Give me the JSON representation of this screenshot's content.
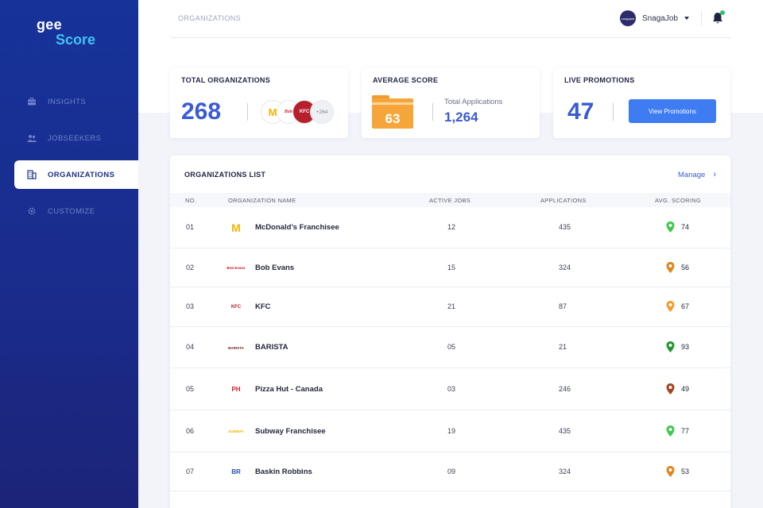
{
  "app": {
    "logo_line1": "gee",
    "logo_line2": "Score"
  },
  "sidebar": {
    "items": [
      {
        "label": "INSIGHTS",
        "icon": "briefcase-icon",
        "active": false
      },
      {
        "label": "JOBSEEKERS",
        "icon": "users-icon",
        "active": false
      },
      {
        "label": "ORGANIZATIONS",
        "icon": "building-icon",
        "active": true
      },
      {
        "label": "CUSTOMIZE",
        "icon": "gear-icon",
        "active": false
      }
    ]
  },
  "header": {
    "breadcrumb": "ORGANIZATIONS",
    "user_name": "SnagaJob",
    "avatar_text": "snagajob"
  },
  "cards": {
    "total_orgs": {
      "title": "TOTAL ORGANIZATIONS",
      "value": "268",
      "more": "+264"
    },
    "avg_score": {
      "title": "AVERAGE SCORE",
      "value": "63",
      "total_apps_label": "Total Applications",
      "total_apps_value": "1,264"
    },
    "promotions": {
      "title": "LIVE  PROMOTIONS",
      "value": "47",
      "button": "View Promotions"
    }
  },
  "list": {
    "title": "ORGANIZATIONS LIST",
    "manage": "Manage",
    "columns": [
      "NO.",
      "ORGANIZATION NAME",
      "ACTIVE JOBS",
      "APPLICATIONS",
      "AVG. SCORING"
    ],
    "rows": [
      {
        "no": "01",
        "name": "McDonald’s Franchisee",
        "jobs": "12",
        "apps": "435",
        "score": "74",
        "pin_color": "#3cc84a",
        "logo_text": "M",
        "logo_color": "#f5b400"
      },
      {
        "no": "02",
        "name": "Bob Evans",
        "jobs": "15",
        "apps": "324",
        "score": "56",
        "pin_color": "#e0861f",
        "logo_text": "Bob Evans",
        "logo_color": "#c8202b"
      },
      {
        "no": "03",
        "name": "KFC",
        "jobs": "21",
        "apps": "87",
        "score": "67",
        "pin_color": "#f29b31",
        "logo_text": "KFC",
        "logo_color": "#b81f2c"
      },
      {
        "no": "04",
        "name": "BARISTA",
        "jobs": "05",
        "apps": "21",
        "score": "93",
        "pin_color": "#21962e",
        "logo_text": "BARISTA",
        "logo_color": "#6a1c1c"
      },
      {
        "no": "05",
        "name": "Pizza Hut - Canada",
        "jobs": "03",
        "apps": "246",
        "score": "49",
        "pin_color": "#a8421a",
        "logo_text": "PH",
        "logo_color": "#d3222a"
      },
      {
        "no": "06",
        "name": "Subway Franchisee",
        "jobs": "19",
        "apps": "435",
        "score": "77",
        "pin_color": "#3cc84a",
        "logo_text": "SUBWAY",
        "logo_color": "#f2b200"
      },
      {
        "no": "07",
        "name": "Baskin Robbins",
        "jobs": "09",
        "apps": "324",
        "score": "53",
        "pin_color": "#e0861f",
        "logo_text": "BR",
        "logo_color": "#1f4fa8"
      }
    ]
  },
  "colors": {
    "accent": "#3a5bd4",
    "sidebar": "#1a2c8c",
    "button": "#3f7cf2",
    "folder": "#f5a53a"
  }
}
